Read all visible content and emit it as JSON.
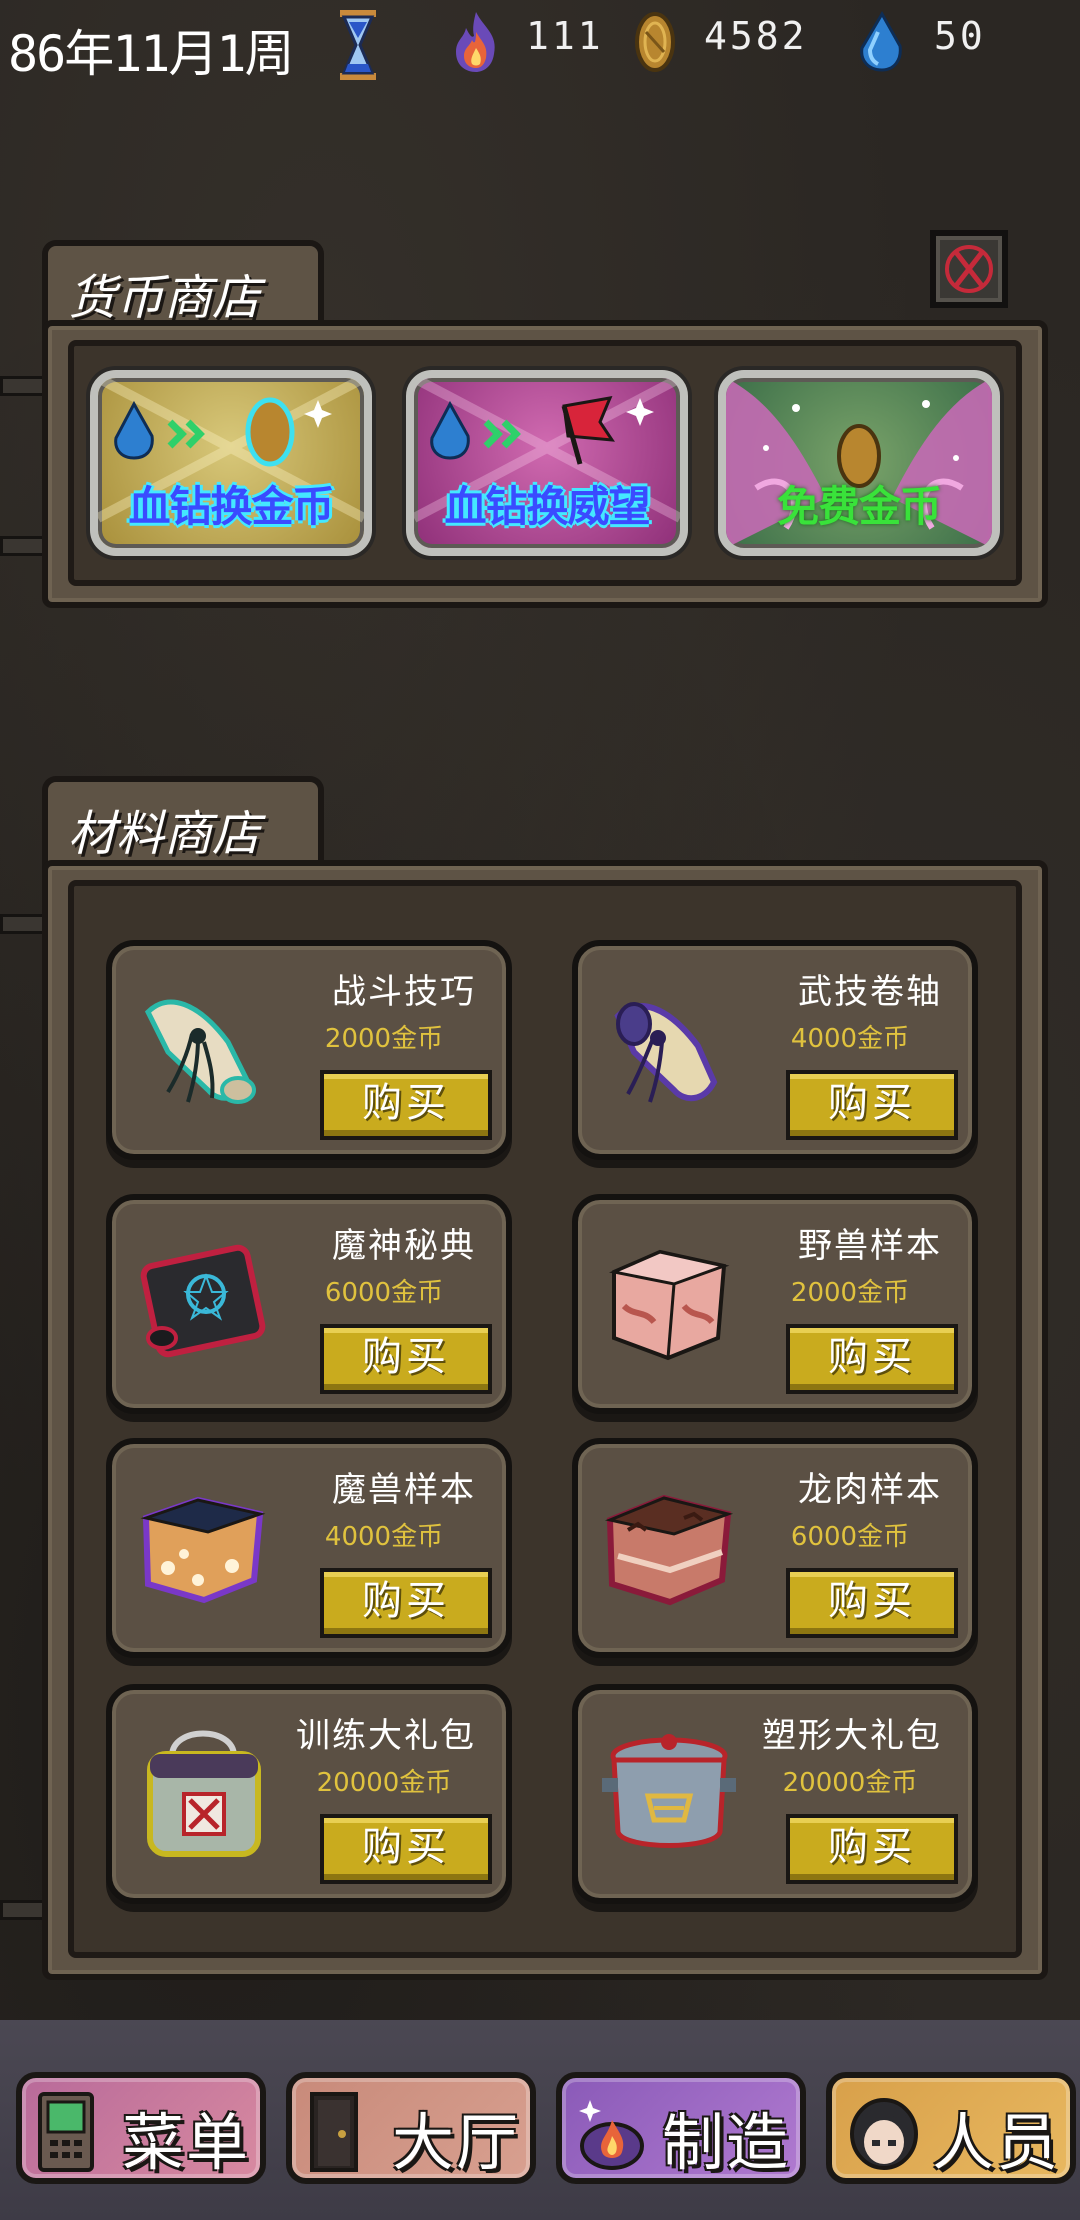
{
  "status": {
    "date": "86年11月1周",
    "fire_value": "111",
    "gold_value": "4582",
    "gem_value": "50"
  },
  "currency_shop": {
    "title": "货币商店",
    "cards": [
      {
        "label": "血钻换金币"
      },
      {
        "label": "血钻换威望"
      },
      {
        "label": "免费金币"
      }
    ]
  },
  "material_shop": {
    "title": "材料商店",
    "buy_label": "购买",
    "items": [
      {
        "name": "战斗技巧",
        "price": "2000金币",
        "icon": "teal-scroll-icon"
      },
      {
        "name": "武技卷轴",
        "price": "4000金币",
        "icon": "purple-scroll-icon"
      },
      {
        "name": "魔神秘典",
        "price": "6000金币",
        "icon": "dark-tome-icon"
      },
      {
        "name": "野兽样本",
        "price": "2000金币",
        "icon": "meat-cube-icon"
      },
      {
        "name": "魔兽样本",
        "price": "4000金币",
        "icon": "demon-meat-icon"
      },
      {
        "name": "龙肉样本",
        "price": "6000金币",
        "icon": "dragon-meat-icon"
      },
      {
        "name": "训练大礼包",
        "price": "20000金币",
        "icon": "training-bag-icon"
      },
      {
        "name": "塑形大礼包",
        "price": "20000金币",
        "icon": "shaping-pot-icon"
      }
    ]
  },
  "bottom_nav": [
    {
      "label": "菜单"
    },
    {
      "label": "大厅"
    },
    {
      "label": "制造"
    },
    {
      "label": "人员"
    }
  ],
  "colors": {
    "background": "#2b2723",
    "panel": "#5e5345",
    "buy_button": "#c9ab1e",
    "price_text": "#e0c23e"
  }
}
